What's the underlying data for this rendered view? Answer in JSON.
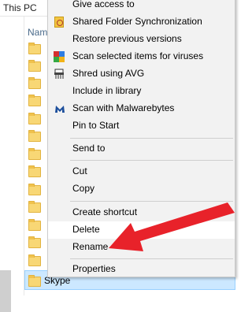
{
  "explorer": {
    "breadcrumb": "This PC",
    "column_header": "Nam",
    "selected_folder": "Skype"
  },
  "menu": {
    "items": [
      {
        "label": "Give access to",
        "icon": ""
      },
      {
        "label": "Shared Folder Synchronization",
        "icon": "shared-folder-sync-icon"
      },
      {
        "label": "Restore previous versions",
        "icon": ""
      },
      {
        "label": "Scan selected items for viruses",
        "icon": "avg-scan-icon"
      },
      {
        "label": "Shred using AVG",
        "icon": "shred-icon"
      },
      {
        "label": "Include in library",
        "icon": ""
      },
      {
        "label": "Scan with Malwarebytes",
        "icon": "malwarebytes-icon"
      },
      {
        "label": "Pin to Start",
        "icon": ""
      },
      {
        "label": "Send to",
        "icon": ""
      },
      {
        "label": "Cut",
        "icon": ""
      },
      {
        "label": "Copy",
        "icon": ""
      },
      {
        "label": "Create shortcut",
        "icon": ""
      },
      {
        "label": "Delete",
        "icon": ""
      },
      {
        "label": "Rename",
        "icon": ""
      },
      {
        "label": "Properties",
        "icon": ""
      }
    ],
    "hovered_item": "Delete"
  },
  "colors": {
    "menu_bg": "#f2f2f2",
    "selection_bg": "#cce8ff",
    "arrow": "#e8222a"
  }
}
